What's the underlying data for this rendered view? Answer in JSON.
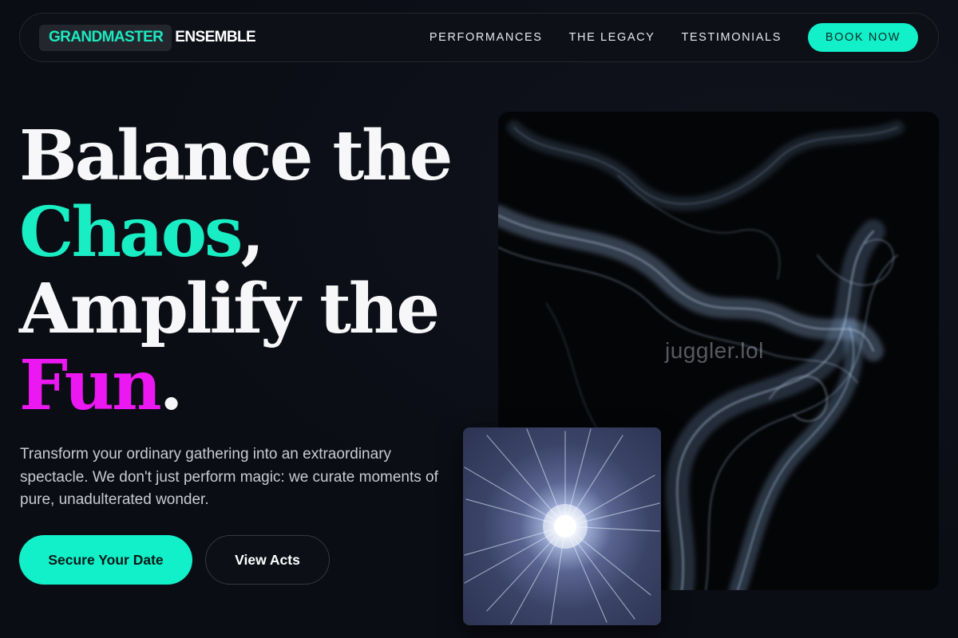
{
  "nav": {
    "brand_highlight": "GRANDMASTER",
    "brand_rest": "ENSEMBLE",
    "links": [
      "PERFORMANCES",
      "THE LEGACY",
      "TESTIMONIALS"
    ],
    "cta": "BOOK NOW"
  },
  "hero": {
    "line1": "Balance the",
    "line2_accent": "Chaos",
    "line2_punct": ",",
    "line3": "Amplify the",
    "line4_accent": "Fun",
    "line4_punct": ".",
    "lead": "Transform your ordinary gathering into an extraordinary spectacle. We don't just perform magic: we curate moments of pure, unadulterated wonder.",
    "primary_button": "Secure Your Date",
    "secondary_button": "View Acts"
  },
  "media": {
    "watermark": "juggler.lol"
  },
  "colors": {
    "accent_cyan": "#12f0c9",
    "accent_magenta": "#ec18f2",
    "background": "#0c0e16"
  }
}
